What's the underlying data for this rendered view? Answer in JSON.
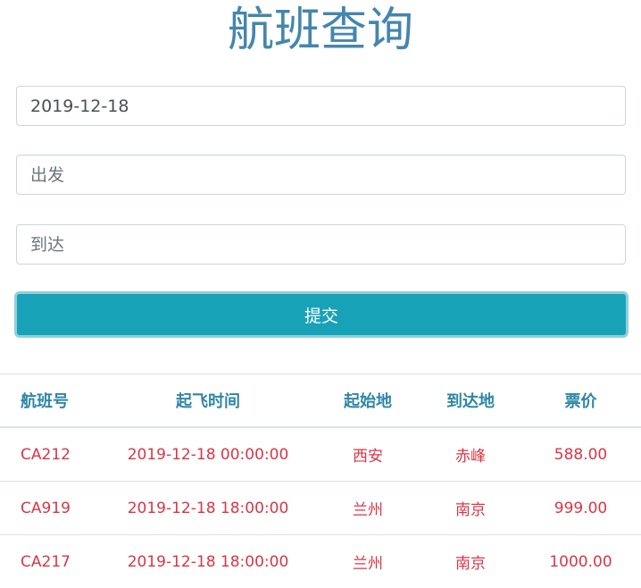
{
  "title": "航班查询",
  "form": {
    "date_value": "2019-12-18",
    "from_placeholder": "出发",
    "to_placeholder": "到达",
    "submit_label": "提交"
  },
  "table": {
    "headers": [
      "航班号",
      "起飞时间",
      "起始地",
      "到达地",
      "票价"
    ],
    "rows": [
      [
        "CA212",
        "2019-12-18 00:00:00",
        "西安",
        "赤峰",
        "588.00"
      ],
      [
        "CA919",
        "2019-12-18 18:00:00",
        "兰州",
        "南京",
        "999.00"
      ],
      [
        "CA217",
        "2019-12-18 18:00:00",
        "兰州",
        "南京",
        "1000.00"
      ]
    ]
  },
  "colors": {
    "title": "#4486ad",
    "header_text": "#2f86a6",
    "cell_text": "#dc3545",
    "button": "#17a2b8"
  }
}
